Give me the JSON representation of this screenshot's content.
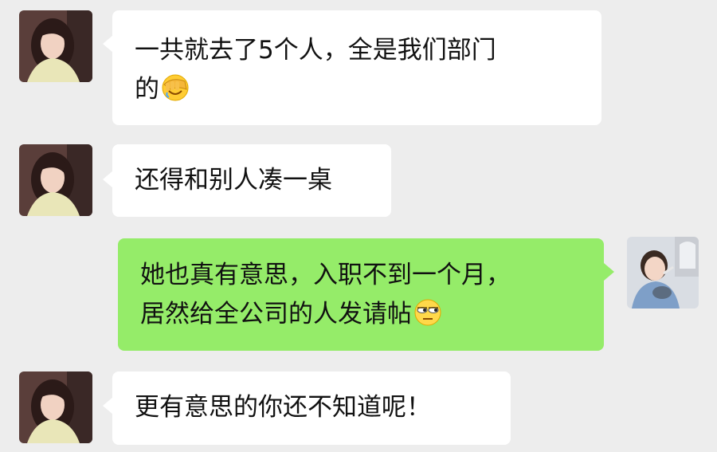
{
  "chat": {
    "messages": [
      {
        "sender": "other",
        "lines": [
          "一共就去了5个人，全是我们部门",
          "的"
        ],
        "emoji": "facepalm-emoji"
      },
      {
        "sender": "other",
        "lines": [
          "还得和别人凑一桌"
        ]
      },
      {
        "sender": "self",
        "lines": [
          "她也真有意思，入职不到一个月，",
          "居然给全公司的人发请帖"
        ],
        "emoji": "unamused-emoji"
      },
      {
        "sender": "other",
        "lines": [
          "更有意思的你还不知道呢！"
        ]
      }
    ]
  },
  "colors": {
    "background": "#ededed",
    "incoming_bubble": "#ffffff",
    "outgoing_bubble": "#95ec69",
    "text": "#111111"
  }
}
